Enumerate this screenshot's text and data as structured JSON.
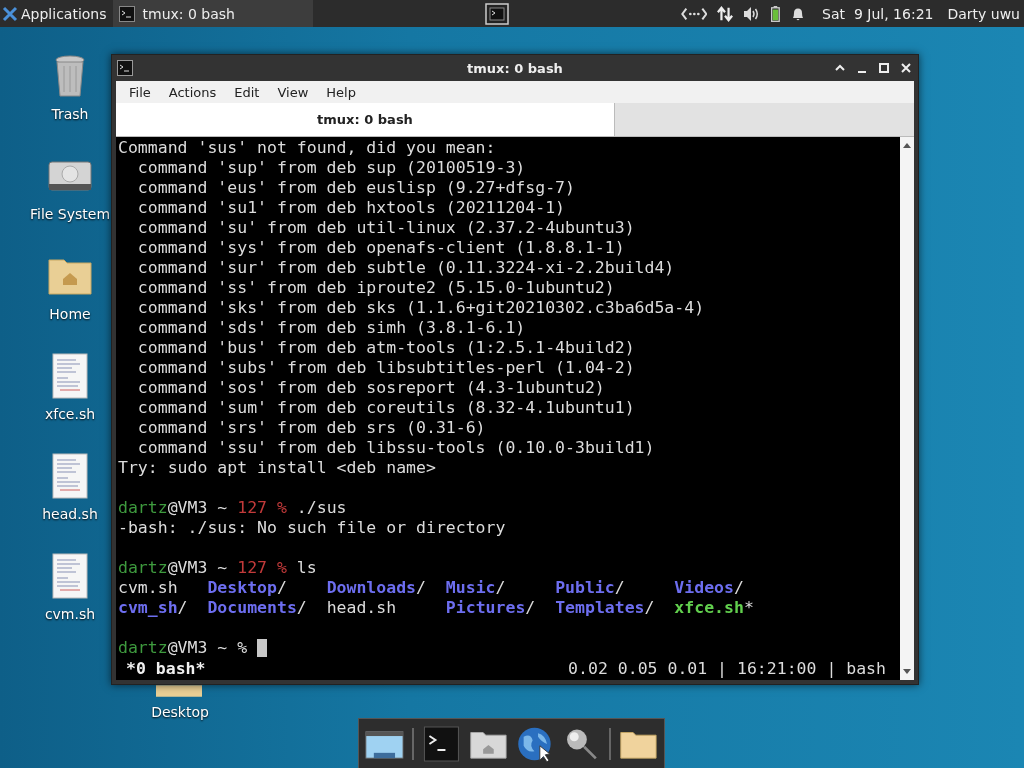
{
  "panel": {
    "apps_label": "Applications",
    "tasks": [
      {
        "label": "tmux: 0 bash",
        "selected": true
      }
    ],
    "clock": "Sat  9 Jul, 16:21",
    "user": "Darty uwu"
  },
  "desktop_icons": [
    {
      "label": "Trash",
      "kind": "trash"
    },
    {
      "label": "File System",
      "kind": "drive"
    },
    {
      "label": "Home",
      "kind": "home"
    },
    {
      "label": "xfce.sh",
      "kind": "script"
    },
    {
      "label": "head.sh",
      "kind": "script"
    },
    {
      "label": "cvm.sh",
      "kind": "script"
    }
  ],
  "hidden_icon": {
    "label": "Desktop"
  },
  "window": {
    "title": "tmux: 0 bash",
    "menu": [
      "File",
      "Actions",
      "Edit",
      "View",
      "Help"
    ],
    "tabs": [
      {
        "label": "tmux: 0 bash",
        "selected": true
      }
    ]
  },
  "terminal": {
    "blocks": [
      {
        "lines": [
          [
            {
              "t": "Command 'sus' not found, did you mean:",
              "kind": "plain"
            }
          ],
          [
            {
              "t": "  command 'sup' from deb sup (20100519-3)",
              "kind": "plain"
            }
          ],
          [
            {
              "t": "  command 'eus' from deb euslisp (9.27+dfsg-7)",
              "kind": "plain"
            }
          ],
          [
            {
              "t": "  command 'su1' from deb hxtools (20211204-1)",
              "kind": "plain"
            }
          ],
          [
            {
              "t": "  command 'su' from deb util-linux (2.37.2-4ubuntu3)",
              "kind": "plain"
            }
          ],
          [
            {
              "t": "  command 'sys' from deb openafs-client (1.8.8.1-1)",
              "kind": "plain"
            }
          ],
          [
            {
              "t": "  command 'sur' from deb subtle (0.11.3224-xi-2.2build4)",
              "kind": "plain"
            }
          ],
          [
            {
              "t": "  command 'ss' from deb iproute2 (5.15.0-1ubuntu2)",
              "kind": "plain"
            }
          ],
          [
            {
              "t": "  command 'sks' from deb sks (1.1.6+git20210302.c3ba6d5a-4)",
              "kind": "plain"
            }
          ],
          [
            {
              "t": "  command 'sds' from deb simh (3.8.1-6.1)",
              "kind": "plain"
            }
          ],
          [
            {
              "t": "  command 'bus' from deb atm-tools (1:2.5.1-4build2)",
              "kind": "plain"
            }
          ],
          [
            {
              "t": "  command 'subs' from deb libsubtitles-perl (1.04-2)",
              "kind": "plain"
            }
          ],
          [
            {
              "t": "  command 'sos' from deb sosreport (4.3-1ubuntu2)",
              "kind": "plain"
            }
          ],
          [
            {
              "t": "  command 'sum' from deb coreutils (8.32-4.1ubuntu1)",
              "kind": "plain"
            }
          ],
          [
            {
              "t": "  command 'srs' from deb srs (0.31-6)",
              "kind": "plain"
            }
          ],
          [
            {
              "t": "  command 'ssu' from deb libssu-tools (0.10.0-3build1)",
              "kind": "plain"
            }
          ],
          [
            {
              "t": "Try: sudo apt install <deb name>",
              "kind": "plain"
            }
          ]
        ]
      },
      {
        "lines": [
          [
            {
              "t": "dartz",
              "kind": "user"
            },
            {
              "t": "@VM3 ~ ",
              "kind": "plain"
            },
            {
              "t": "127 %",
              "kind": "code"
            },
            {
              "t": " ./sus",
              "kind": "plain"
            }
          ],
          [
            {
              "t": "-bash: ./sus: No such file or directory",
              "kind": "plain"
            }
          ]
        ]
      },
      {
        "lines": [
          [
            {
              "t": "dartz",
              "kind": "user"
            },
            {
              "t": "@VM3 ~ ",
              "kind": "plain"
            },
            {
              "t": "127 %",
              "kind": "code"
            },
            {
              "t": " ls",
              "kind": "plain"
            }
          ],
          [
            {
              "t": "cvm.sh   ",
              "kind": "plain"
            },
            {
              "t": "Desktop",
              "kind": "dir"
            },
            {
              "t": "/    ",
              "kind": "plain"
            },
            {
              "t": "Downloads",
              "kind": "dir"
            },
            {
              "t": "/  ",
              "kind": "plain"
            },
            {
              "t": "Music",
              "kind": "dir"
            },
            {
              "t": "/     ",
              "kind": "plain"
            },
            {
              "t": "Public",
              "kind": "dir"
            },
            {
              "t": "/     ",
              "kind": "plain"
            },
            {
              "t": "Videos",
              "kind": "dir"
            },
            {
              "t": "/",
              "kind": "plain"
            }
          ],
          [
            {
              "t": "cvm_sh",
              "kind": "dir"
            },
            {
              "t": "/  ",
              "kind": "plain"
            },
            {
              "t": "Documents",
              "kind": "dir"
            },
            {
              "t": "/  head.sh     ",
              "kind": "plain"
            },
            {
              "t": "Pictures",
              "kind": "dir"
            },
            {
              "t": "/  ",
              "kind": "plain"
            },
            {
              "t": "Templates",
              "kind": "dir"
            },
            {
              "t": "/  ",
              "kind": "plain"
            },
            {
              "t": "xfce.sh",
              "kind": "exec"
            },
            {
              "t": "*",
              "kind": "plain"
            }
          ]
        ]
      },
      {
        "lines": [
          [
            {
              "t": "dartz",
              "kind": "user"
            },
            {
              "t": "@VM3 ~ % ",
              "kind": "plain"
            }
          ]
        ]
      }
    ],
    "cursor": true,
    "status_left": "*0 bash*",
    "status_right": "0.02 0.05 0.01 | 16:21:00 | bash"
  },
  "dock": [
    {
      "kind": "desktop"
    },
    {
      "kind": "terminal"
    },
    {
      "kind": "home"
    },
    {
      "kind": "web"
    },
    {
      "kind": "search"
    },
    {
      "kind": "folder"
    }
  ]
}
